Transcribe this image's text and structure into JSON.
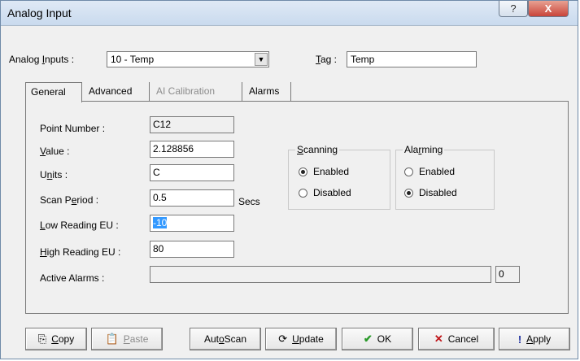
{
  "window": {
    "title": "Analog Input",
    "help_symbol": "?",
    "close_symbol": "X"
  },
  "header": {
    "analog_inputs_label_pre": "Analog ",
    "analog_inputs_label_u": "I",
    "analog_inputs_label_post": "nputs :",
    "analog_inputs_value": "10 - Temp",
    "tag_label_u": "T",
    "tag_label_post": "ag :",
    "tag_value": "Temp"
  },
  "tabs": [
    {
      "label": "General",
      "state": "active"
    },
    {
      "label": "Advanced",
      "state": "normal"
    },
    {
      "label": "AI Calibration",
      "state": "disabled"
    },
    {
      "label": "Alarms",
      "state": "normal"
    }
  ],
  "general": {
    "point_number_label": "Point Number :",
    "point_number_value": "C12",
    "value_label_u": "V",
    "value_label_post": "alue :",
    "value_value": "2.128856",
    "units_label_pre": "U",
    "units_label_u": "n",
    "units_label_post": "its :",
    "units_value": "C",
    "scan_period_label_pre": "Scan P",
    "scan_period_label_u": "e",
    "scan_period_label_post": "riod :",
    "scan_period_value": "0.5",
    "scan_period_unit": "Secs",
    "low_label_u": "L",
    "low_label_post": "ow Reading EU :",
    "low_value": "-10",
    "high_label_u": "H",
    "high_label_post": "igh Reading EU :",
    "high_value": "80",
    "active_alarms_label": "Active Alarms :",
    "active_alarms_value": "",
    "active_alarms_count": "0"
  },
  "scanning": {
    "title_u": "S",
    "title_post": "canning",
    "options": [
      {
        "label": "Enabled",
        "selected": true
      },
      {
        "label": "Disabled",
        "selected": false
      }
    ]
  },
  "alarming": {
    "title_pre": "Ala",
    "title_u": "r",
    "title_post": "ming",
    "options": [
      {
        "label": "Enabled",
        "selected": false
      },
      {
        "label": "Disabled",
        "selected": true
      }
    ]
  },
  "buttons": {
    "copy_u": "C",
    "copy_post": "opy",
    "paste_u": "P",
    "paste_post": "aste",
    "autoscan_pre": "Aut",
    "autoscan_u": "o",
    "autoscan_post": " Scan",
    "update_u": "U",
    "update_post": "pdate",
    "ok": "OK",
    "cancel": "Cancel",
    "apply_u": "A",
    "apply_post": "pply"
  }
}
